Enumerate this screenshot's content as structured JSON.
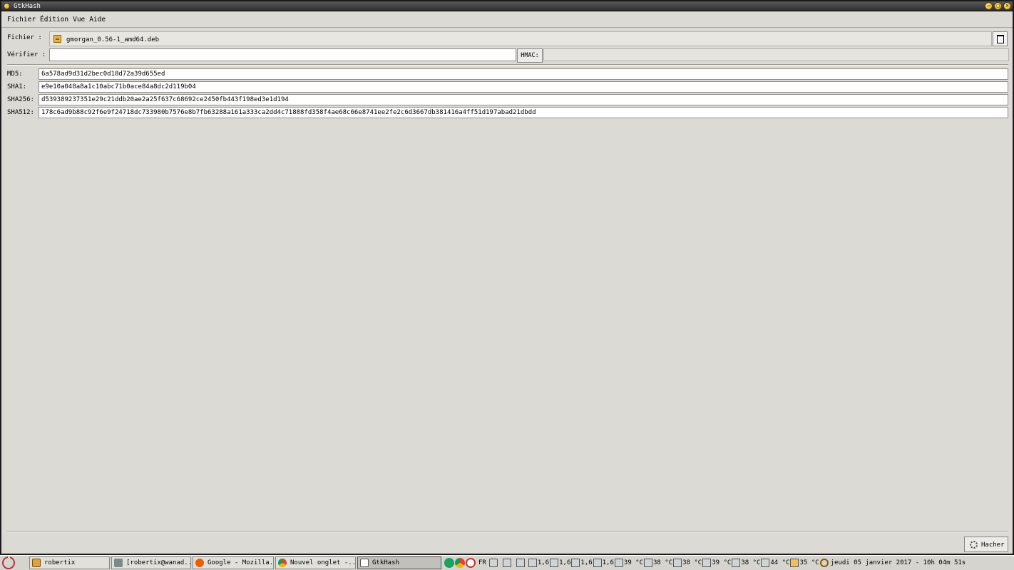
{
  "window": {
    "title": "GtkHash"
  },
  "menubar": {
    "items": [
      "Fichier",
      "Édition",
      "Vue",
      "Aide"
    ]
  },
  "file": {
    "label": "Fichier :",
    "filename": "gmorgan_0.56-1_amd64.deb"
  },
  "verify": {
    "label": "Vérifier :",
    "value": "",
    "hmac_label": "HMAC:",
    "hmac_value": ""
  },
  "hashes": [
    {
      "label": "MD5:",
      "value": "6a578ad9d31d2bec0d18d72a39d655ed"
    },
    {
      "label": "SHA1:",
      "value": "e9e10a048a8a1c10abc71b0ace84a8dc2d119b04"
    },
    {
      "label": "SHA256:",
      "value": "d539389237351e29c21ddb20ae2a25f637c68692ce2450fb443f198ed3e1d194"
    },
    {
      "label": "SHA512:",
      "value": "178c6ad9b88c92f6e9f24718dc733980b7576e8b7fb63288a161a333ca2dd4c71888fd358f4ae68c66e8741ee2fe2c6d3667db381416a4ff51d197abad21dbdd"
    }
  ],
  "actions": {
    "hash_label": "Hacher"
  },
  "taskbar": {
    "tasks": [
      {
        "label": "robertix",
        "icon": "folder-icon",
        "color": "#d9a441"
      },
      {
        "label": "[robertix@wanad...",
        "icon": "terminal-icon",
        "color": "#7a8a8a"
      },
      {
        "label": "Google - Mozilla...",
        "icon": "firefox-icon",
        "color": "#e66000"
      },
      {
        "label": "Nouvel onglet -...",
        "icon": "chrome-icon",
        "color": "#4285f4"
      },
      {
        "label": "GtkHash",
        "icon": "window-icon",
        "color": "#ffffff",
        "active": true
      }
    ],
    "tray": {
      "lang": "FR",
      "cpu": [
        "1,6",
        "1,6",
        "1,6",
        "1,6"
      ],
      "temps": [
        "39 °C",
        "38 °C",
        "38 °C",
        "39 °C",
        "38 °C",
        "44 °C",
        "35 °C"
      ],
      "clock": "jeudi 05 janvier 2017 - 10h 04m 51s"
    }
  }
}
